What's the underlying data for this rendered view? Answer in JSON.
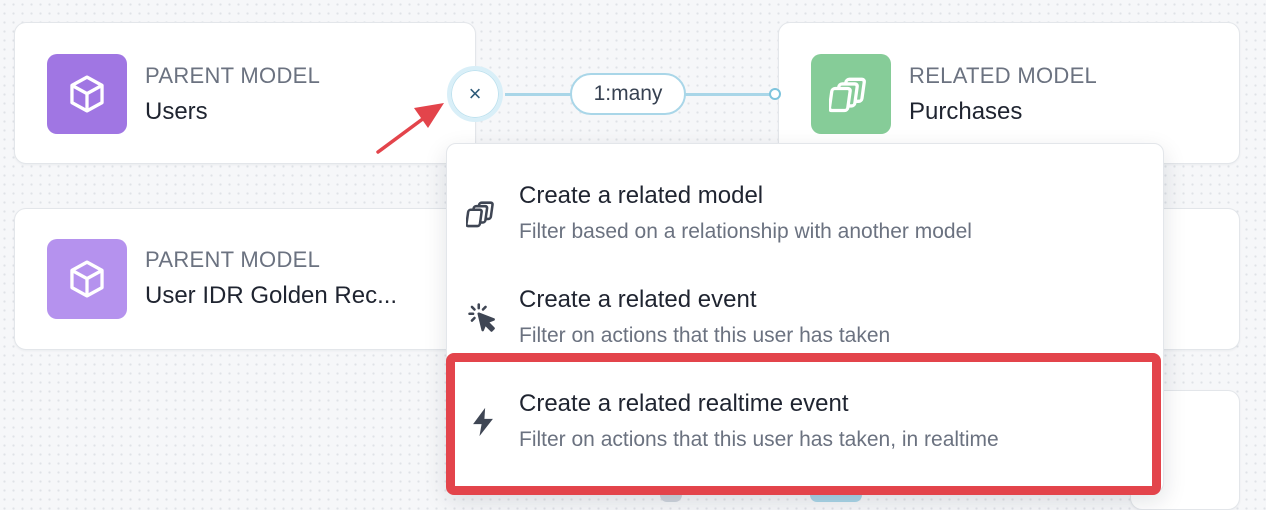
{
  "cards": [
    {
      "kicker": "PARENT MODEL",
      "title": "Users",
      "icon": "cube-icon",
      "color": "#a076e3"
    },
    {
      "kicker": "PARENT MODEL",
      "title": "User IDR Golden Rec...",
      "icon": "cube-icon",
      "color": "#b592ee"
    },
    {
      "kicker": "RELATED MODEL",
      "title": "Purchases",
      "icon": "stacked-cards-icon",
      "color": "#86cc98"
    }
  ],
  "relationship": {
    "cardinality": "1:many",
    "close_symbol": "×"
  },
  "menu": {
    "items": [
      {
        "title": "Create a related model",
        "description": "Filter based on a relationship with another model",
        "icon": "stacked-cards-icon"
      },
      {
        "title": "Create a related event",
        "description": "Filter on actions that this user has taken",
        "icon": "cursor-click-icon"
      },
      {
        "title": "Create a related realtime event",
        "description": "Filter on actions that this user has taken, in realtime",
        "icon": "lightning-icon"
      }
    ]
  },
  "colors": {
    "highlight": "#e3444b",
    "arrow": "#e3444b",
    "link": "#a9d6e8"
  }
}
